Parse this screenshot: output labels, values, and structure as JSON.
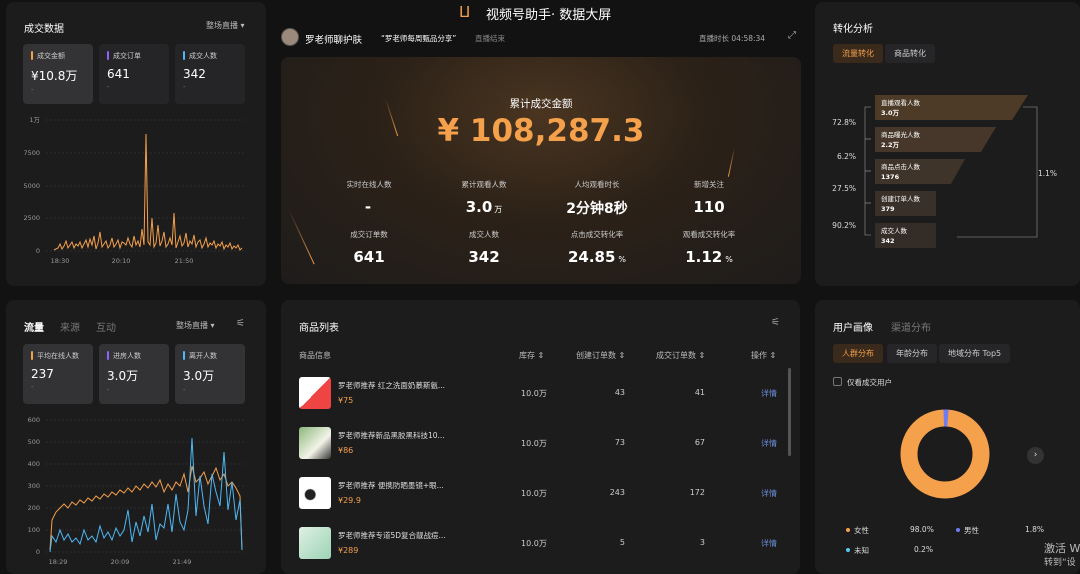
{
  "header": {
    "title": "视频号助手· 数据大屏",
    "host": "罗老师聊护肤",
    "live_title": "“罗老师每周甄品分享”",
    "live_status": "直播结束",
    "duration": "直播时长 04:58:34"
  },
  "deal": {
    "title": "成交数据",
    "dropdown": "整场直播 ▾",
    "stats": [
      {
        "label": "成交金额",
        "value": "¥10.8万",
        "sub": "-",
        "color": "#f5a04a"
      },
      {
        "label": "成交订单",
        "value": "641",
        "sub": "-",
        "color": "#8f63f5"
      },
      {
        "label": "成交人数",
        "value": "342",
        "sub": "-",
        "color": "#4fb8f5"
      }
    ],
    "yticks": [
      "1万",
      "7500",
      "5000",
      "2500",
      "0"
    ],
    "xticks": [
      "18:30",
      "20:10",
      "21:50"
    ]
  },
  "main": {
    "total_label": "累计成交金额",
    "total_value": "¥ 108,287.3",
    "metrics": [
      {
        "label": "实时在线人数",
        "value": "-",
        "unit": ""
      },
      {
        "label": "累计观看人数",
        "value": "3.0",
        "unit": "万"
      },
      {
        "label": "人均观看时长",
        "value": "2分钟8秒",
        "unit": ""
      },
      {
        "label": "新增关注",
        "value": "110",
        "unit": ""
      },
      {
        "label": "成交订单数",
        "value": "641",
        "unit": ""
      },
      {
        "label": "成交人数",
        "value": "342",
        "unit": ""
      },
      {
        "label": "点击成交转化率",
        "value": "24.85",
        "unit": "%"
      },
      {
        "label": "观看成交转化率",
        "value": "1.12",
        "unit": "%"
      }
    ]
  },
  "conv": {
    "title": "转化分析",
    "tabs": [
      "流量转化",
      "商品转化"
    ],
    "funnel": [
      {
        "label": "直播观看人数",
        "value": "3.0万"
      },
      {
        "label": "商品曝光人数",
        "value": "2.2万"
      },
      {
        "label": "商品点击人数",
        "value": "1376"
      },
      {
        "label": "创建订单人数",
        "value": "379"
      },
      {
        "label": "成交人数",
        "value": "342"
      }
    ],
    "rates": [
      "72.8%",
      "6.2%",
      "27.5%",
      "90.2%"
    ],
    "overall": "1.1%"
  },
  "flow": {
    "tabs": [
      "流量",
      "来源",
      "互动"
    ],
    "dropdown": "整场直播 ▾",
    "stats": [
      {
        "label": "平均在线人数",
        "value": "237",
        "sub": "-",
        "color": "#f5a04a"
      },
      {
        "label": "进房人数",
        "value": "3.0万",
        "sub": "-",
        "color": "#8f63f5"
      },
      {
        "label": "离开人数",
        "value": "3.0万",
        "sub": "-",
        "color": "#4fb8f5"
      }
    ],
    "yticks": [
      "600",
      "500",
      "400",
      "300",
      "200",
      "100",
      "0"
    ],
    "xticks": [
      "18:29",
      "20:09",
      "21:49"
    ]
  },
  "products": {
    "title": "商品列表",
    "headers": [
      "商品信息",
      "库存 ⇕",
      "创建订单数 ⇕",
      "成交订单数 ⇕",
      "操作 ⇕"
    ],
    "rows": [
      {
        "name": "罗老师推荐 红之洗面奶慕斯氨...",
        "price": "¥75",
        "stock": "10.0万",
        "created": "43",
        "done": "41",
        "op": "详情"
      },
      {
        "name": "罗老师推荐新品黑胶黑科技10...",
        "price": "¥86",
        "stock": "10.0万",
        "created": "73",
        "done": "67",
        "op": "详情"
      },
      {
        "name": "罗老师推荐 便携防晒墨镜+眼...",
        "price": "¥29.9",
        "stock": "10.0万",
        "created": "243",
        "done": "172",
        "op": "详情"
      },
      {
        "name": "罗老师推荐专道5D复合靓战痘...",
        "price": "¥289",
        "stock": "10.0万",
        "created": "5",
        "done": "3",
        "op": "详情"
      }
    ]
  },
  "users": {
    "tabs": [
      "用户画像",
      "渠道分布"
    ],
    "subtabs": [
      "人群分布",
      "年龄分布",
      "地域分布 Top5"
    ],
    "checkbox": "仅看成交用户",
    "legend": [
      {
        "label": "女性",
        "value": "98.0%",
        "color": "#f5a04a"
      },
      {
        "label": "男性",
        "value": "1.8%",
        "color": "#6f7cf5"
      },
      {
        "label": "未知",
        "value": "0.2%",
        "color": "#56c8f5"
      }
    ]
  },
  "watermark": {
    "line1": "激活 W",
    "line2": "转到“设"
  }
}
